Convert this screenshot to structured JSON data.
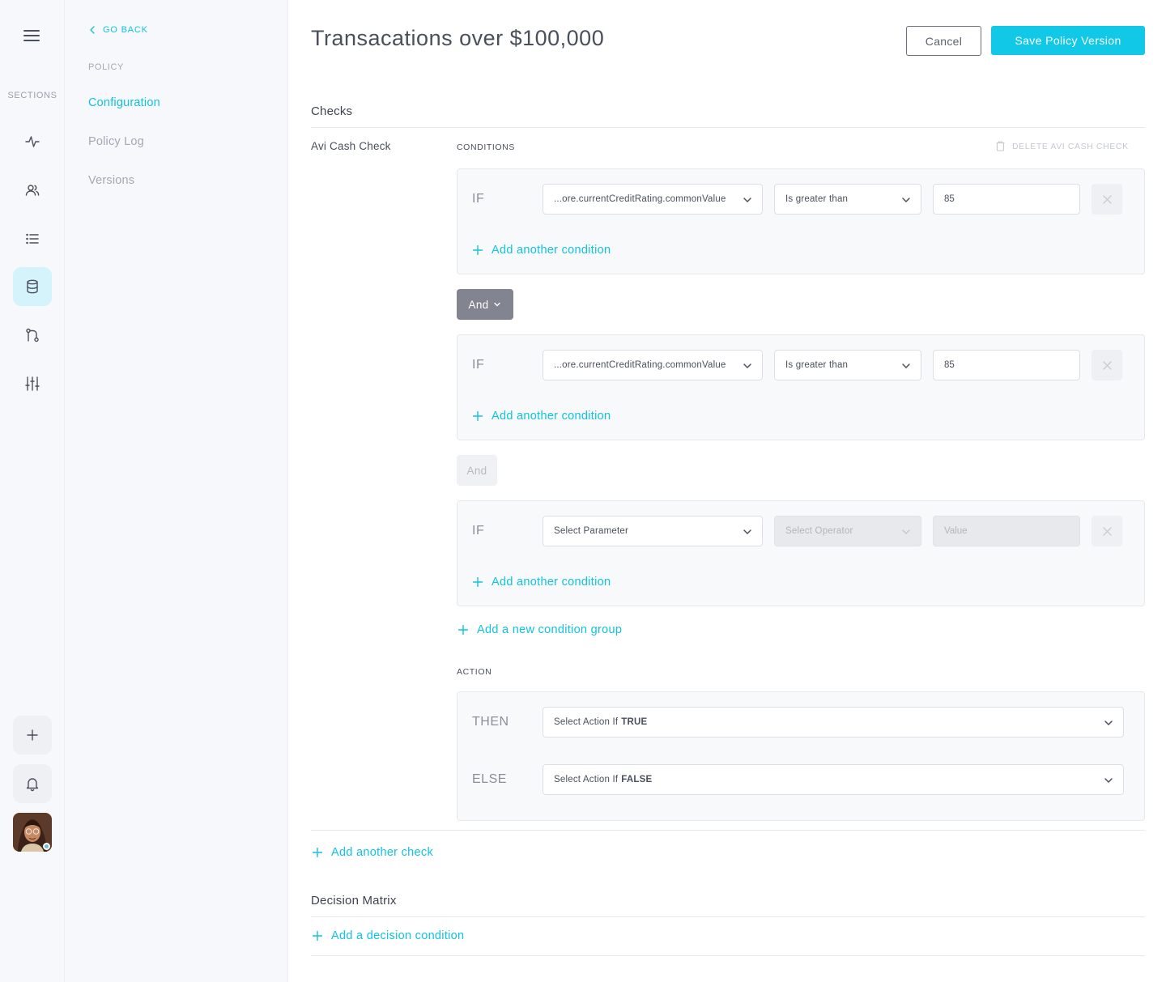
{
  "colors": {
    "accent": "#11c9e6",
    "link": "#11c3de",
    "and_active": "#82858f",
    "rail_active": "#d5f3fb"
  },
  "rail": {
    "sections_label": "SECTIONS",
    "icons": [
      "activity-icon",
      "users-icon",
      "list-icon",
      "database-icon",
      "git-branch-icon",
      "sliders-icon",
      "plus-icon",
      "bell-icon"
    ]
  },
  "subnav": {
    "go_back": "GO BACK",
    "group_label": "POLICY",
    "items": [
      {
        "label": "Configuration",
        "active": true
      },
      {
        "label": "Policy Log",
        "active": false
      },
      {
        "label": "Versions",
        "active": false
      }
    ]
  },
  "header": {
    "title": "Transacations over $100,000",
    "cancel_label": "Cancel",
    "save_label": "Save Policy Version"
  },
  "checks": {
    "title": "Checks",
    "check_name": "Avi Cash Check",
    "conditions_label": "CONDITIONS",
    "delete_label": "DELETE AVI CASH CHECK",
    "groups": [
      {
        "if_label": "IF",
        "parameter": "...ore.currentCreditRating.commonValue",
        "operator": "Is greater than",
        "value": "85",
        "add_condition": "Add another condition"
      },
      {
        "if_label": "IF",
        "parameter": "...ore.currentCreditRating.commonValue",
        "operator": "Is greater than",
        "value": "85",
        "add_condition": "Add another condition"
      },
      {
        "if_label": "IF",
        "parameter": "Select Parameter",
        "operator": "Select Operator",
        "value": "Value",
        "add_condition": "Add another condition"
      }
    ],
    "connectors": [
      "And",
      "And"
    ],
    "add_group": "Add a new condition group",
    "action_label": "ACTION",
    "then_label": "THEN",
    "then_prefix": "Select Action If",
    "then_bold": "TRUE",
    "else_label": "ELSE",
    "else_prefix": "Select Action If",
    "else_bold": "FALSE",
    "add_check": "Add another check"
  },
  "decision": {
    "title": "Decision Matrix",
    "add_condition": "Add a decision condition"
  }
}
